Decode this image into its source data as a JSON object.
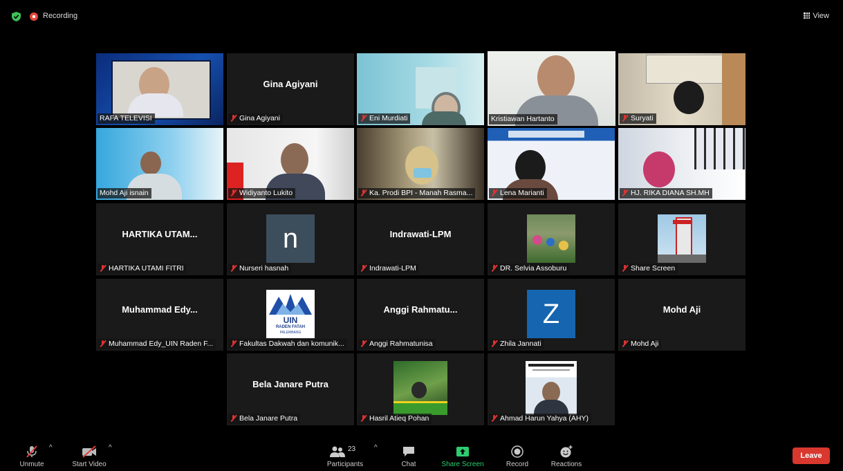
{
  "topbar": {
    "recording_label": "Recording",
    "view_label": "View"
  },
  "participants": [
    {
      "name": "RAFA TELEVISI",
      "display": "",
      "kind": "video",
      "muted": false
    },
    {
      "name": "Gina Agiyani",
      "display": "Gina Agiyani",
      "kind": "name",
      "muted": true
    },
    {
      "name": "Eni Murdiati",
      "display": "",
      "kind": "video",
      "muted": true
    },
    {
      "name": "Kristiawan Hartanto",
      "display": "",
      "kind": "video",
      "muted": false,
      "active_speaker": true
    },
    {
      "name": "Suryati",
      "display": "",
      "kind": "video",
      "muted": true
    },
    {
      "name": "Mohd Aji isnain",
      "display": "",
      "kind": "video",
      "muted": false
    },
    {
      "name": "Widiyanto Lukito",
      "display": "",
      "kind": "video",
      "muted": true
    },
    {
      "name": "Ka. Prodi BPI - Manah Rasma...",
      "display": "",
      "kind": "video",
      "muted": true
    },
    {
      "name": "Lena Marianti",
      "display": "",
      "kind": "video",
      "muted": true
    },
    {
      "name": "HJ. RIKA DIANA SH.MH",
      "display": "",
      "kind": "video",
      "muted": true
    },
    {
      "name": "HARTIKA UTAMI FITRI",
      "display": "HARTIKA UTAM...",
      "kind": "name",
      "muted": true
    },
    {
      "name": "Nurseri hasnah",
      "display": "n",
      "kind": "avatar",
      "avatar_color": "#3c4e5c",
      "muted": true
    },
    {
      "name": "Indrawati-LPM",
      "display": "Indrawati-LPM",
      "kind": "name",
      "muted": true
    },
    {
      "name": "DR. Selvia Assoburu",
      "display": "",
      "kind": "picture",
      "muted": true
    },
    {
      "name": "Share Screen",
      "display": "",
      "kind": "picture",
      "muted": true
    },
    {
      "name": "Muhammad Edy_UIN Raden F...",
      "display": "Muhammad Edy...",
      "kind": "name",
      "muted": true
    },
    {
      "name": "Fakultas Dakwah dan komunik...",
      "display": "",
      "kind": "logo",
      "logo_text": "UIN",
      "logo_sub": "RADEN FATAH",
      "logo_sub2": "PALEMBANG",
      "muted": true
    },
    {
      "name": "Anggi Rahmatunisa",
      "display": "Anggi Rahmatu...",
      "kind": "name",
      "muted": true
    },
    {
      "name": "Zhila Jannati",
      "display": "Z",
      "kind": "avatar",
      "avatar_color": "#1565b0",
      "muted": true
    },
    {
      "name": "Mohd Aji",
      "display": "Mohd Aji",
      "kind": "name",
      "muted": true
    },
    {
      "name": "Bela Janare Putra",
      "display": "Bela Janare Putra",
      "kind": "name",
      "muted": true
    },
    {
      "name": "Hasril Atieq Pohan",
      "display": "",
      "kind": "picture",
      "muted": true
    },
    {
      "name": "Ahmad Harun Yahya (AHY)",
      "display": "",
      "kind": "picture",
      "muted": true
    }
  ],
  "toolbar": {
    "unmute": "Unmute",
    "start_video": "Start Video",
    "participants": "Participants",
    "participant_count": "23",
    "chat": "Chat",
    "share_screen": "Share Screen",
    "record": "Record",
    "reactions": "Reactions",
    "leave": "Leave"
  },
  "colors": {
    "accent_green": "#2ecc71",
    "active_speaker": "#a8d84f",
    "leave_red": "#d9382f",
    "mute_red": "#dd3333"
  }
}
